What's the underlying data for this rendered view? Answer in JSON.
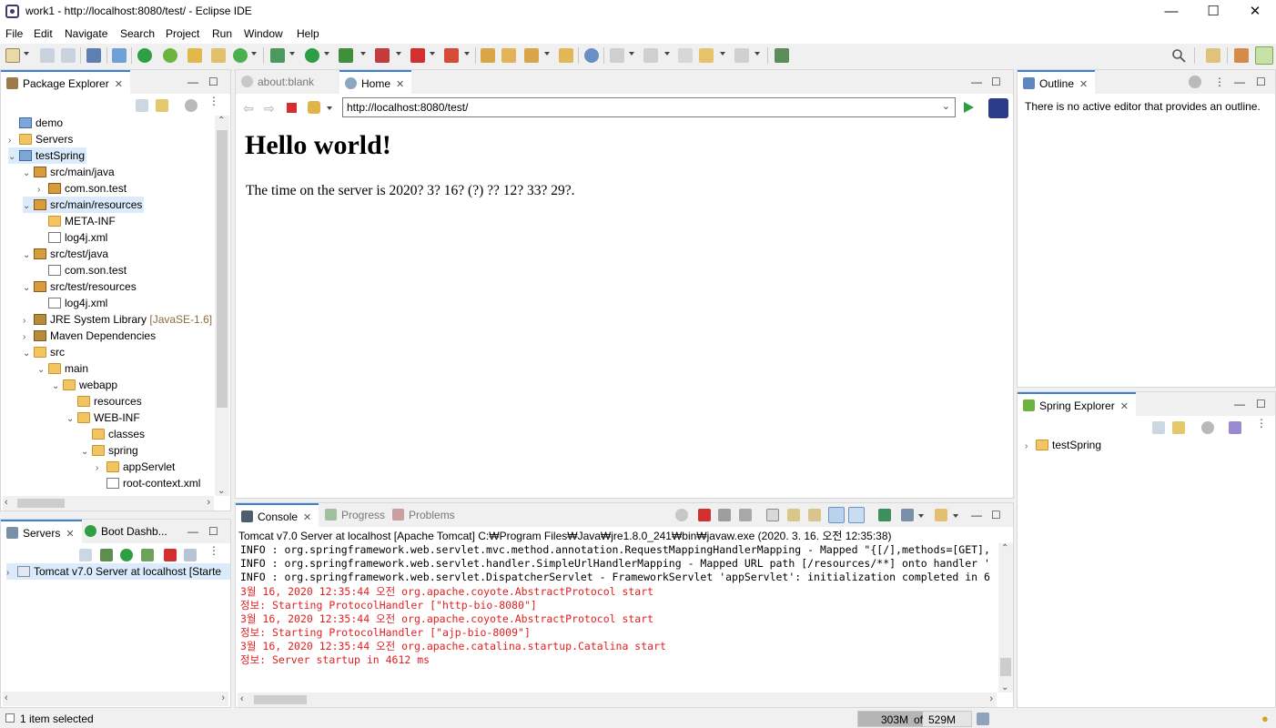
{
  "window": {
    "title": "work1 - http://localhost:8080/test/ - Eclipse IDE",
    "minimize": "—",
    "maximize": "☐",
    "close": "✕"
  },
  "menu": [
    "File",
    "Edit",
    "Navigate",
    "Search",
    "Project",
    "Run",
    "Window",
    "Help"
  ],
  "package_explorer": {
    "title": "Package Explorer",
    "items": [
      {
        "label": "demo",
        "extra": ""
      },
      {
        "label": "Servers",
        "extra": ""
      },
      {
        "label": "testSpring",
        "extra": ""
      },
      {
        "label": "src/main/java",
        "extra": ""
      },
      {
        "label": "com.son.test",
        "extra": ""
      },
      {
        "label": "src/main/resources",
        "extra": ""
      },
      {
        "label": "META-INF",
        "extra": ""
      },
      {
        "label": "log4j.xml",
        "extra": ""
      },
      {
        "label": "src/test/java",
        "extra": ""
      },
      {
        "label": "com.son.test",
        "extra": ""
      },
      {
        "label": "src/test/resources",
        "extra": ""
      },
      {
        "label": "log4j.xml",
        "extra": ""
      },
      {
        "label": "JRE System Library",
        "extra": "[JavaSE-1.6]"
      },
      {
        "label": "Maven Dependencies",
        "extra": ""
      },
      {
        "label": "src",
        "extra": ""
      },
      {
        "label": "main",
        "extra": ""
      },
      {
        "label": "webapp",
        "extra": ""
      },
      {
        "label": "resources",
        "extra": ""
      },
      {
        "label": "WEB-INF",
        "extra": ""
      },
      {
        "label": "classes",
        "extra": ""
      },
      {
        "label": "spring",
        "extra": ""
      },
      {
        "label": "appServlet",
        "extra": ""
      },
      {
        "label": "root-context.xml",
        "extra": ""
      }
    ]
  },
  "servers_panel": {
    "tabs": [
      "Servers",
      "Boot Dashb..."
    ],
    "server_row": "Tomcat v7.0 Server at localhost  [Starte"
  },
  "browser": {
    "tabs": [
      "about:blank",
      "Home"
    ],
    "url": "http://localhost:8080/test/",
    "heading": "Hello world!",
    "body_text": "The time on the server is 2020? 3? 16? (?) ?? 12? 33? 29?."
  },
  "outline": {
    "title": "Outline",
    "message": "There is no active editor that provides an outline."
  },
  "spring_explorer": {
    "title": "Spring Explorer",
    "item": "testSpring"
  },
  "console": {
    "tabs": [
      "Console",
      "Progress",
      "Problems"
    ],
    "header": "Tomcat v7.0 Server at localhost [Apache Tomcat] C:₩Program Files₩Java₩jre1.8.0_241₩bin₩javaw.exe (2020. 3. 16. 오전 12:35:38)",
    "lines": [
      {
        "text": "INFO : org.springframework.web.servlet.mvc.method.annotation.RequestMappingHandlerMapping - Mapped \"{[/],methods=[GET],",
        "kind": "info"
      },
      {
        "text": "INFO : org.springframework.web.servlet.handler.SimpleUrlHandlerMapping - Mapped URL path [/resources/**] onto handler '",
        "kind": "info"
      },
      {
        "text": "INFO : org.springframework.web.servlet.DispatcherServlet - FrameworkServlet 'appServlet': initialization completed in 6",
        "kind": "info"
      },
      {
        "text": "3월 16, 2020 12:35:44 오전 org.apache.coyote.AbstractProtocol start",
        "kind": "err"
      },
      {
        "text": "정보: Starting ProtocolHandler [\"http-bio-8080\"]",
        "kind": "err"
      },
      {
        "text": "3월 16, 2020 12:35:44 오전 org.apache.coyote.AbstractProtocol start",
        "kind": "err"
      },
      {
        "text": "정보: Starting ProtocolHandler [\"ajp-bio-8009\"]",
        "kind": "err"
      },
      {
        "text": "3월 16, 2020 12:35:44 오전 org.apache.catalina.startup.Catalina start",
        "kind": "err"
      },
      {
        "text": "정보: Server startup in 4612 ms",
        "kind": "err"
      }
    ]
  },
  "status": {
    "selection": "1 item selected",
    "heap_used": "303M",
    "heap_of": "of",
    "heap_total": "529M"
  }
}
